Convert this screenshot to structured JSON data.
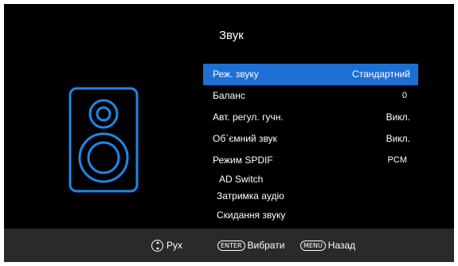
{
  "menu": {
    "title": "Звук",
    "items": [
      {
        "label": "Реж. звуку",
        "value": "Стандартний",
        "selected": true
      },
      {
        "label": "Баланс",
        "value": "0"
      },
      {
        "label": "Авт. регул. гучн.",
        "value": "Викл."
      },
      {
        "label": "Об`ємний звук",
        "value": "Викл."
      },
      {
        "label": "Режим SPDIF",
        "value": "PCM"
      },
      {
        "label": "AD Switch",
        "value": ""
      },
      {
        "label": "Затримка аудіо",
        "value": ""
      },
      {
        "label": "Скидання звуку",
        "value": ""
      }
    ]
  },
  "footer": {
    "move_label": "Рух",
    "enter_key": "ENTER",
    "select_label": "Вибрати",
    "menu_key": "MENU",
    "back_label": "Назад"
  },
  "colors": {
    "accent": "#1e6fd4",
    "icon": "#1e88e5",
    "footer_bg": "#2a2a2a"
  },
  "icons": {
    "main": "speaker-icon",
    "nav": "nav-updown-icon"
  }
}
